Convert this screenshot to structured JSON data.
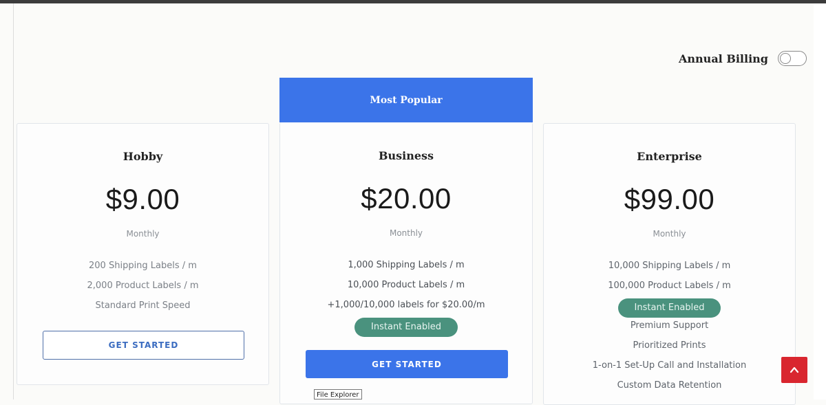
{
  "billing": {
    "label": "Annual Billing",
    "enabled": false
  },
  "popular_label": "Most Popular",
  "plans": [
    {
      "name": "Hobby",
      "price": "$9.00",
      "period": "Monthly",
      "features": [
        "200 Shipping Labels / m",
        "2,000 Product Labels / m",
        "Standard Print Speed"
      ],
      "cta": "GET STARTED"
    },
    {
      "name": "Business",
      "price": "$20.00",
      "period": "Monthly",
      "features": [
        "1,000 Shipping Labels / m",
        "10,000 Product Labels / m",
        "+1,000/10,000 labels for $20.00/m"
      ],
      "badge": "Instant Enabled",
      "cta": "GET STARTED"
    },
    {
      "name": "Enterprise",
      "price": "$99.00",
      "period": "Monthly",
      "features": [
        "10,000 Shipping Labels / m",
        "100,000 Product Labels / m"
      ],
      "badge": "Instant Enabled",
      "extra_features": [
        "Premium Support",
        "Prioritized Prints",
        "1-on-1 Set-Up Call and Installation",
        "Custom Data Retention"
      ]
    }
  ],
  "icons": {
    "prev": "chevron-left-icon",
    "next": "chevron-right-icon",
    "scroll_top": "chevron-up-icon"
  },
  "tooltip": "File Explorer",
  "colors": {
    "accent": "#3b74e9",
    "badge": "#4a927e",
    "scroll_top": "#d9262f"
  }
}
